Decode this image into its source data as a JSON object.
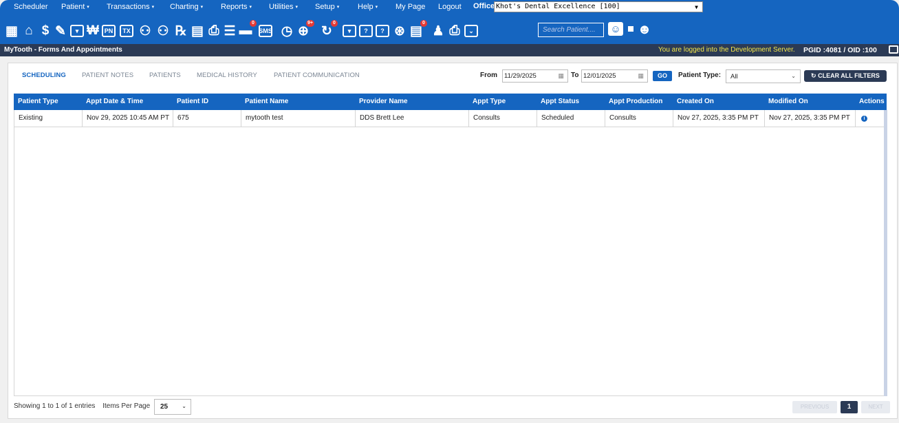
{
  "menu": {
    "items": [
      {
        "label": "Scheduler",
        "caret": ""
      },
      {
        "label": "Patient",
        "caret": "▾"
      },
      {
        "label": "Transactions",
        "caret": "▾"
      },
      {
        "label": "Charting",
        "caret": "▾"
      },
      {
        "label": "Reports",
        "caret": "▾"
      },
      {
        "label": "Utilities",
        "caret": "▾"
      },
      {
        "label": "Setup",
        "caret": "▾"
      },
      {
        "label": "Help",
        "caret": "▾"
      },
      {
        "label": "My Page",
        "caret": ""
      },
      {
        "label": "Logout",
        "caret": ""
      }
    ],
    "office_label": "Office",
    "office_value": "Khot's Dental Excellence [100]"
  },
  "toolbar": {
    "icons": [
      "calendar-icon",
      "home-icon",
      "dollar-icon",
      "notes-icon",
      "tooth-icon",
      "tooth-chart-icon",
      "pn-icon",
      "tx-icon",
      "add-user-icon",
      "add-user-alt-icon",
      "rx-icon",
      "message-icon",
      "print-icon",
      "document-list-icon",
      "chat-badge-icon",
      "sms-icon",
      "clock-icon",
      "globe-badge-icon",
      "refresh-badge-icon",
      "tooth-box-icon",
      "tooth-box-2-icon",
      "tooth-box-3-icon",
      "globe-settings-icon",
      "document-badge-icon",
      "family-icon",
      "printer-icon",
      "chevron-down-box-icon"
    ],
    "badges": {
      "chat": "0",
      "sms": "SMS",
      "globe": "9+",
      "refresh": "0",
      "document": "0"
    },
    "search_placeholder": "Search Patient...."
  },
  "subheader": {
    "title": "MyTooth - Forms And Appointments",
    "server_msg": "You are logged into the Development Server.",
    "ids": "PGID :4081  /  OID :100"
  },
  "tabs": [
    "SCHEDULING",
    "PATIENT NOTES",
    "PATIENTS",
    "MEDICAL HISTORY",
    "PATIENT COMMUNICATION"
  ],
  "filters": {
    "from_label": "From",
    "from_value": "11/29/2025",
    "to_label": "To",
    "to_value": "12/01/2025",
    "go_label": "GO",
    "ptype_label": "Patient Type:",
    "ptype_value": "All",
    "clear_label": "CLEAR ALL FILTERS",
    "clear_icon": "↻"
  },
  "table": {
    "headers": [
      "Patient Type",
      "Appt Date & Time",
      "Patient ID",
      "Patient Name",
      "Provider Name",
      "Appt Type",
      "Appt Status",
      "Appt Production",
      "Created On",
      "Modified On",
      "Actions"
    ],
    "rows": [
      [
        "Existing",
        "Nov 29, 2025 10:45 AM PT",
        "675",
        "mytooth test",
        "DDS Brett Lee",
        "Consults",
        "Scheduled",
        "Consults",
        "Nov 27, 2025, 3:35 PM PT",
        "Nov 27, 2025, 3:35 PM PT",
        "i"
      ]
    ]
  },
  "footer": {
    "showing": "Showing 1 to 1 of 1 entries",
    "ipp_label": "Items Per Page",
    "ipp_value": "25",
    "prev": "PREVIOUS",
    "page": "1",
    "next": "NEXT"
  }
}
